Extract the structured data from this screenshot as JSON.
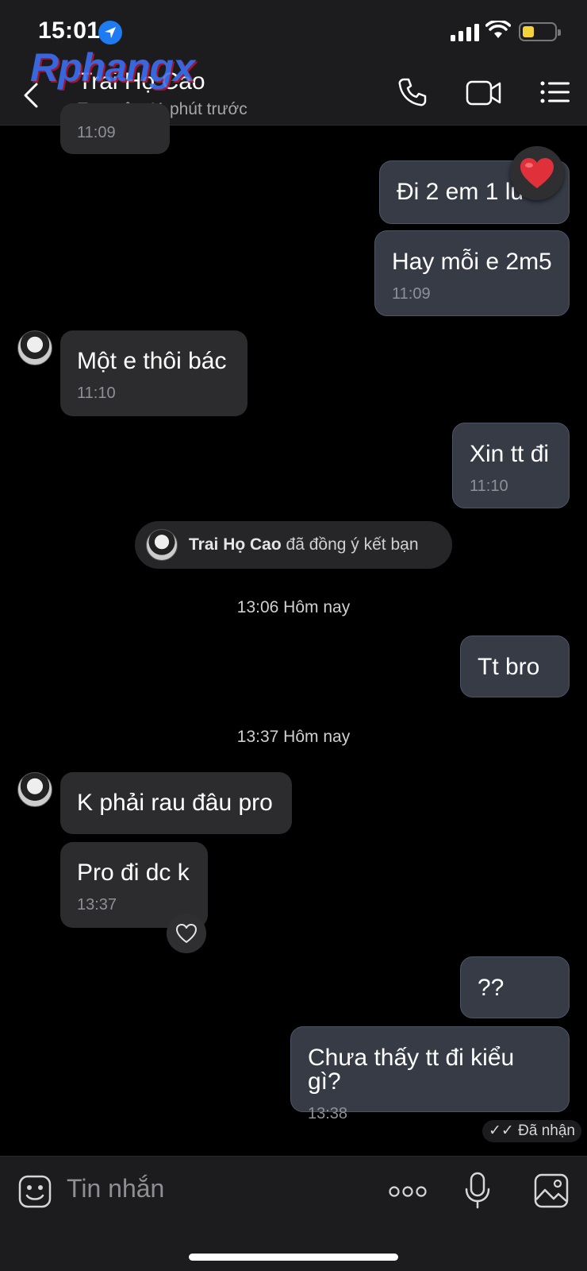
{
  "status_bar": {
    "time": "15:01"
  },
  "watermark": "Rphangx",
  "header": {
    "contact_name": "Trai Họ Cao",
    "last_seen": "Truy cập 41 phút trước"
  },
  "messages": [
    {
      "direction": "in",
      "text": "",
      "time": "11:09"
    },
    {
      "direction": "out",
      "text": "Đi 2 em 1 lu",
      "time": ""
    },
    {
      "direction": "out",
      "text": "Hay mỗi e 2m5",
      "time": "11:09"
    },
    {
      "direction": "in",
      "text": "Một e thôi bác",
      "time": "11:10"
    },
    {
      "direction": "out",
      "text": "Xin tt đi",
      "time": "11:10"
    },
    {
      "direction": "out",
      "text": "Tt bro",
      "time": ""
    },
    {
      "direction": "in",
      "text": "K phải rau đâu pro",
      "time": ""
    },
    {
      "direction": "in",
      "text": "Pro đi dc k",
      "time": "13:37"
    },
    {
      "direction": "out",
      "text": "??",
      "time": ""
    },
    {
      "direction": "out",
      "text": "Chưa thấy tt đi kiểu gì?",
      "time": "13:38"
    }
  ],
  "system_event": {
    "name": "Trai Họ Cao",
    "action": "đã đồng ý kết bạn"
  },
  "dividers": [
    "13:06 Hôm nay",
    "13:37 Hôm nay"
  ],
  "delivery_status": "Đã nhận",
  "composer": {
    "placeholder": "Tin nhắn"
  },
  "colors": {
    "accent_blue": "#1f7bf2",
    "outgoing_bubble": "#363b46",
    "incoming_bubble": "#2c2c2e",
    "heart": "#e0303a"
  }
}
